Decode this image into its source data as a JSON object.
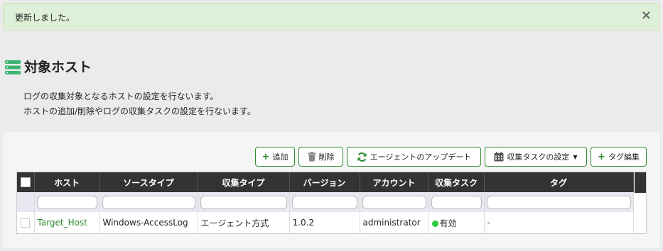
{
  "alert": {
    "message": "更新しました。",
    "close": "×"
  },
  "page": {
    "title": "対象ホスト",
    "icon": "server-list-icon",
    "description_line1": "ログの収集対象となるホストの設定を行ないます。",
    "description_line2": "ホストの追加/削除やログの収集タスクの設定を行ないます。"
  },
  "toolbar": {
    "add_label": "追加",
    "delete_label": "削除",
    "update_agent_label": "エージェントのアップデート",
    "task_settings_label": "収集タスクの設定",
    "edit_tags_label": "タグ編集",
    "accent_color": "#2e8b2e"
  },
  "table": {
    "columns": [
      "ホスト",
      "ソースタイプ",
      "収集タイプ",
      "バージョン",
      "アカウント",
      "収集タスク",
      "タグ"
    ],
    "rows": [
      {
        "host": "Target_Host",
        "source_type": "Windows-AccessLog",
        "collection_type": "エージェント方式",
        "version": "1.0.2",
        "account": "administrator",
        "task_status": "有効",
        "tag": "-"
      }
    ]
  }
}
